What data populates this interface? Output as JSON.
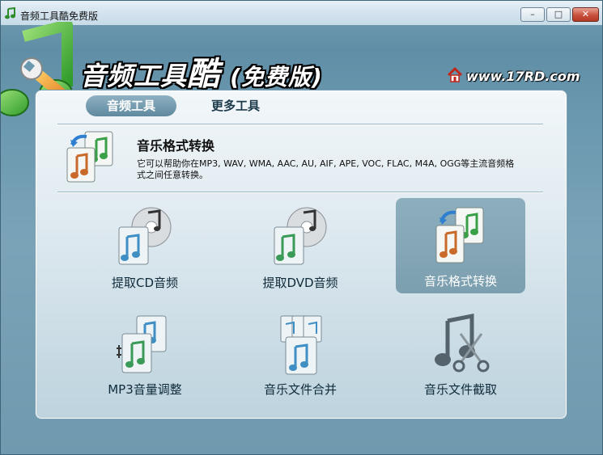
{
  "window": {
    "title": "音频工具酷免费版",
    "controls": {
      "minimize": "–",
      "maximize": "□",
      "close": "✕"
    }
  },
  "header": {
    "app_title_main": "音频工具",
    "app_title_big": "酷",
    "app_title_sub": "(免费版)",
    "website": "www.17RD.com"
  },
  "tabs": [
    {
      "label": "音频工具",
      "active": true
    },
    {
      "label": "更多工具",
      "active": false
    }
  ],
  "feature": {
    "title": "音乐格式转换",
    "description": "它可以帮助你在MP3, WAV, WMA, AAC, AU, AIF, APE, VOC, FLAC, M4A, OGG等主流音频格式之间任意转换。"
  },
  "tools": [
    {
      "label": "提取CD音频",
      "icon": "cd-music-icon",
      "selected": false
    },
    {
      "label": "提取DVD音频",
      "icon": "dvd-music-icon",
      "selected": false
    },
    {
      "label": "音乐格式转换",
      "icon": "format-convert-icon",
      "selected": true
    },
    {
      "label": "MP3音量调整",
      "icon": "volume-adjust-icon",
      "selected": false
    },
    {
      "label": "音乐文件合并",
      "icon": "merge-files-icon",
      "selected": false
    },
    {
      "label": "音乐文件截取",
      "icon": "cut-music-icon",
      "selected": false
    }
  ],
  "colors": {
    "window_bg": "#6a98af",
    "panel_bg": "#dfeaf0",
    "active_tab": "#7a9eb0",
    "selected_tool": "#85a7b7",
    "close_button": "#c8503c"
  }
}
